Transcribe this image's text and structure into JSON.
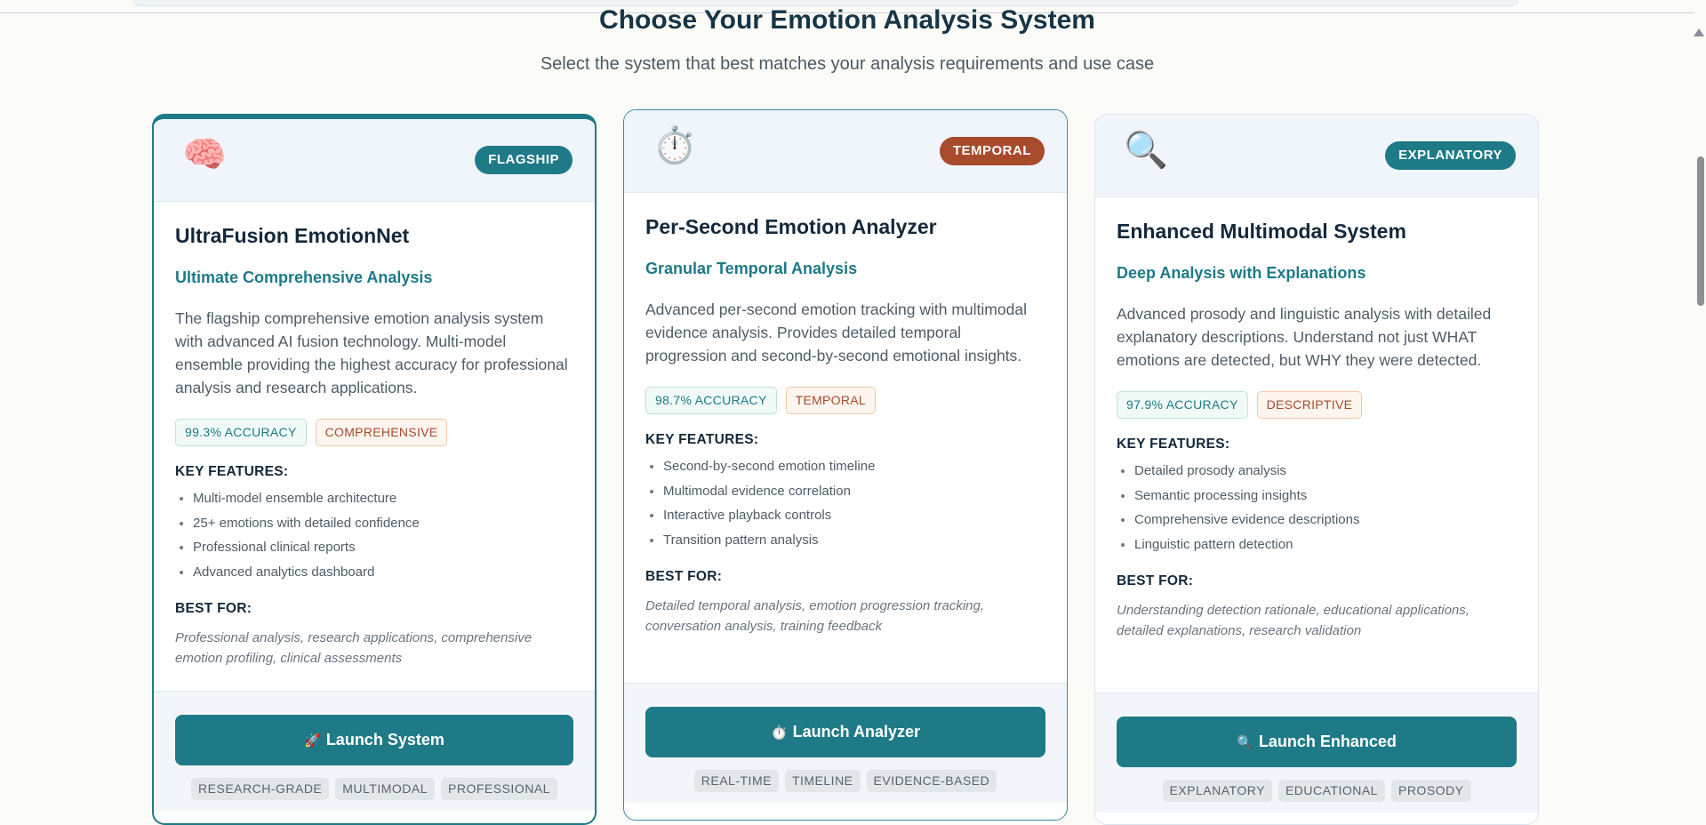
{
  "header": {
    "title": "Choose Your Emotion Analysis System",
    "subtitle": "Select the system that best matches your analysis requirements and use case"
  },
  "labels": {
    "key_features": "KEY FEATURES:",
    "best_for": "BEST FOR:"
  },
  "colors": {
    "primary_teal": "#1e7a86",
    "accent_rust": "#a84a2c",
    "background": "#fbfcf8"
  },
  "cards": [
    {
      "icon": "brain-icon",
      "emoji": "🧠",
      "badge": "FLAGSHIP",
      "name": "UltraFusion EmotionNet",
      "tagline": "Ultimate Comprehensive Analysis",
      "description": "The flagship comprehensive emotion analysis system with advanced AI fusion technology. Multi-model ensemble providing the highest accuracy for professional analysis and research applications.",
      "accuracy": "99.3% ACCURACY",
      "category": "COMPREHENSIVE",
      "features": [
        "Multi-model ensemble architecture",
        "25+ emotions with detailed confidence",
        "Professional clinical reports",
        "Advanced analytics dashboard"
      ],
      "best_for": "Professional analysis, research applications, comprehensive emotion profiling, clinical assessments",
      "button_icon": "rocket-icon",
      "button_emoji": "🚀",
      "button_label": "Launch System",
      "tags": [
        "RESEARCH-GRADE",
        "MULTIMODAL",
        "PROFESSIONAL"
      ]
    },
    {
      "icon": "stopwatch-icon",
      "emoji": "⏱️",
      "badge": "TEMPORAL",
      "name": "Per-Second Emotion Analyzer",
      "tagline": "Granular Temporal Analysis",
      "description": "Advanced per-second emotion tracking with multimodal evidence analysis. Provides detailed temporal progression and second-by-second emotional insights.",
      "accuracy": "98.7% ACCURACY",
      "category": "TEMPORAL",
      "features": [
        "Second-by-second emotion timeline",
        "Multimodal evidence correlation",
        "Interactive playback controls",
        "Transition pattern analysis"
      ],
      "best_for": "Detailed temporal analysis, emotion progression tracking, conversation analysis, training feedback",
      "button_icon": "stopwatch-icon",
      "button_emoji": "⏱️",
      "button_label": "Launch Analyzer",
      "tags": [
        "REAL-TIME",
        "TIMELINE",
        "EVIDENCE-BASED"
      ]
    },
    {
      "icon": "magnifier-icon",
      "emoji": "🔍",
      "badge": "EXPLANATORY",
      "name": "Enhanced Multimodal System",
      "tagline": "Deep Analysis with Explanations",
      "description": "Advanced prosody and linguistic analysis with detailed explanatory descriptions. Understand not just WHAT emotions are detected, but WHY they were detected.",
      "accuracy": "97.9% ACCURACY",
      "category": "DESCRIPTIVE",
      "features": [
        "Detailed prosody analysis",
        "Semantic processing insights",
        "Comprehensive evidence descriptions",
        "Linguistic pattern detection"
      ],
      "best_for": "Understanding detection rationale, educational applications, detailed explanations, research validation",
      "button_icon": "magnifier-icon",
      "button_emoji": "🔍",
      "button_label": "Launch Enhanced",
      "tags": [
        "EXPLANATORY",
        "EDUCATIONAL",
        "PROSODY"
      ]
    }
  ]
}
